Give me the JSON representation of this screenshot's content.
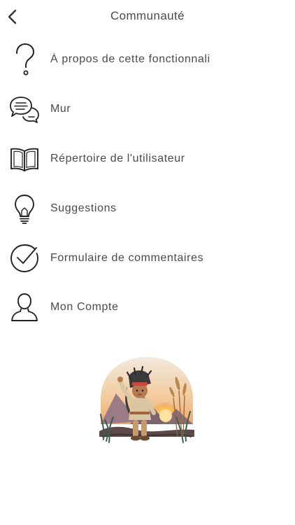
{
  "header": {
    "title": "Communauté"
  },
  "menu": {
    "items": [
      {
        "label": "À propos de cette fonctionnali",
        "icon": "question-mark-icon"
      },
      {
        "label": "Mur",
        "icon": "chat-bubbles-icon"
      },
      {
        "label": "Répertoire de l'utilisateur",
        "icon": "open-book-icon"
      },
      {
        "label": "Suggestions",
        "icon": "lightbulb-icon"
      },
      {
        "label": "Formulaire de commentaires",
        "icon": "check-circle-icon"
      },
      {
        "label": "Mon Compte",
        "icon": "user-icon"
      }
    ]
  },
  "illustration": {
    "subject": "child-waving-sunset-illustration"
  },
  "colors": {
    "text": "#4a4a4a",
    "icon_stroke": "#222222",
    "background": "#ffffff"
  }
}
